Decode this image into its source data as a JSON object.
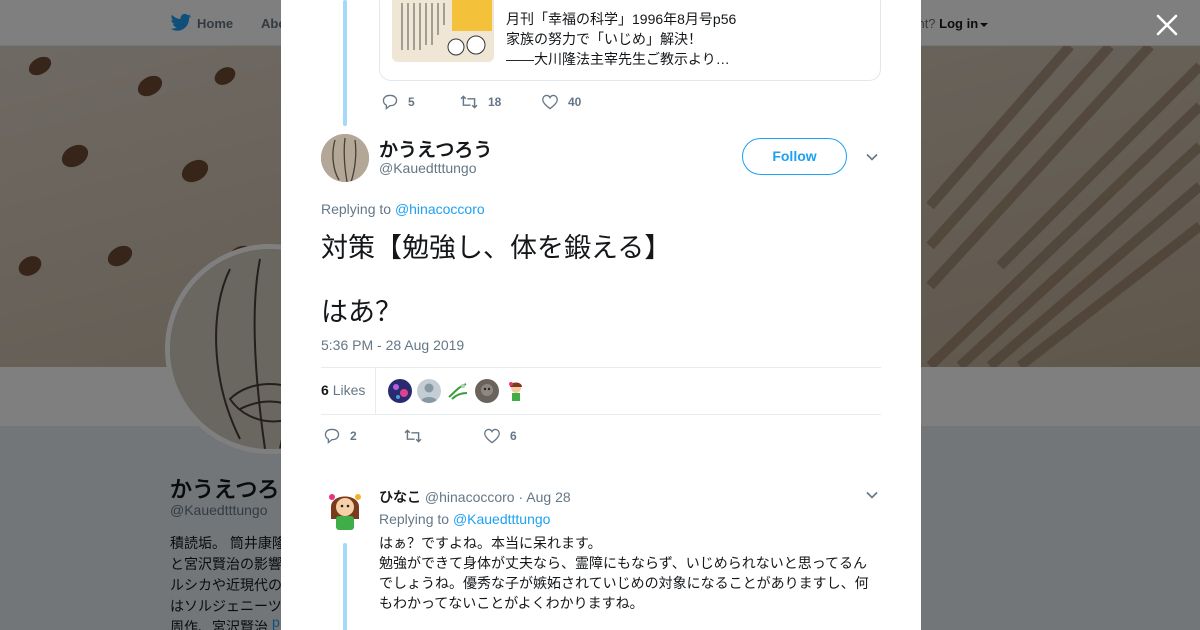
{
  "topnav": {
    "home_label": "Home",
    "about_label": "Abo",
    "account_prompt": "ccount?",
    "login_label": "Log in"
  },
  "profile": {
    "name": "かうえつろ",
    "handle": "@Kauedtttungo",
    "bio": "積読垢。 筒井康隆\nと宮沢賢治の影響\nルシカや近現代の\nはソルジェニーツ\n周作、宮沢賢治 ",
    "bio_link": "p"
  },
  "quoted_tweet": {
    "lines": [
      "月刊「幸福の科学」1996年8月号p56",
      "家族の努力で「いじめ」解決！",
      "――大川隆法主宰先生ご教示より…"
    ],
    "actions": {
      "reply_count": "5",
      "retweet_count": "18",
      "like_count": "40"
    }
  },
  "main_tweet": {
    "author_name": "かうえつろう",
    "author_handle": "@Kauedtttungo",
    "follow_label": "Follow",
    "replying_prefix": "Replying to ",
    "replying_to": "@hinacoccoro",
    "line1": "対策【勉強し、体を鍛える】",
    "line2": "はあ？",
    "timestamp": "5:36 PM - 28 Aug 2019",
    "likes_number": "6",
    "likes_label": "Likes",
    "actions": {
      "reply_count": "2",
      "retweet_count": "",
      "like_count": "6"
    }
  },
  "reply_tweet": {
    "author_name": "ひなこ",
    "author_handle": "@hinacoccoro",
    "separator": "·",
    "date": "Aug 28",
    "replying_prefix": "Replying to ",
    "replying_to": "@Kauedtttungo",
    "text": "はぁ？ですよね。本当に呆れます。\n勉強ができて身体が丈夫なら、霊障にもならず、いじめられないと思ってるんでしょうね。優秀な子が嫉妬されていじめの対象になることがありますし、何もわかってないことがよくわかりますね。"
  },
  "colors": {
    "accent": "#1da1f2",
    "thread_line": "#a4d9f9",
    "muted_text": "#657786",
    "overlay": "rgba(0,0,0,0.5)"
  },
  "icons": [
    "twitter-bird-icon",
    "close-icon",
    "reply-icon",
    "retweet-icon",
    "heart-icon",
    "chevron-down-icon"
  ]
}
